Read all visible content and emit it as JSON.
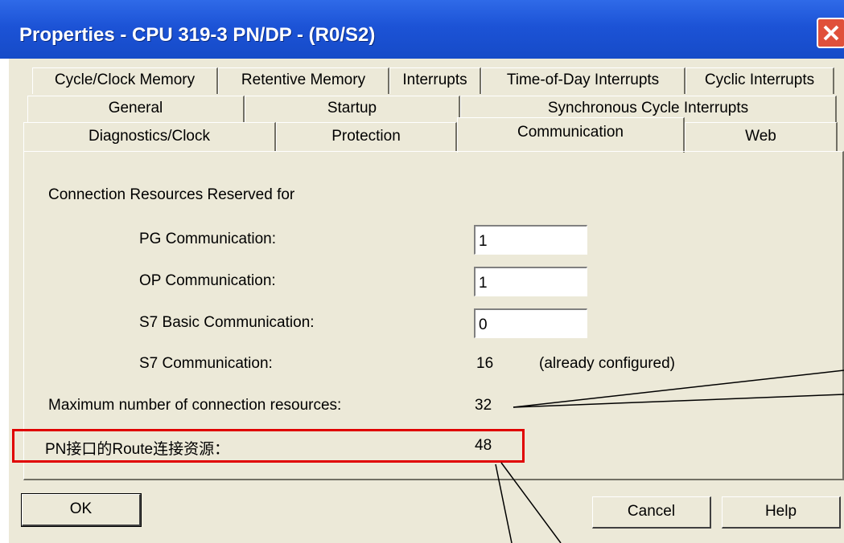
{
  "window": {
    "title": "Properties - CPU 319-3 PN/DP - (R0/S2)"
  },
  "tabs": {
    "row1": [
      "Cycle/Clock Memory",
      "Retentive Memory",
      "Interrupts",
      "Time-of-Day Interrupts",
      "Cyclic Interrupts"
    ],
    "row2": [
      "General",
      "Startup",
      "Synchronous Cycle Interrupts"
    ],
    "row3": [
      "Diagnostics/Clock",
      "Protection",
      "Communication",
      "Web"
    ],
    "active": "Communication"
  },
  "communication": {
    "section_title": "Connection Resources Reserved for",
    "pg_label": "PG Communication:",
    "pg_value": "1",
    "op_label": "OP Communication:",
    "op_value": "1",
    "s7basic_label": "S7 Basic Communication:",
    "s7basic_value": "0",
    "s7_label": "S7 Communication:",
    "s7_value": "16",
    "s7_note": "(already configured)",
    "max_label": "Maximum number of connection resources:",
    "max_value": "32",
    "route_label": "PN接口的Route连接资源：",
    "route_value": "48"
  },
  "buttons": {
    "ok": "OK",
    "cancel": "Cancel",
    "help": "Help"
  },
  "colors": {
    "titlebar": "#1c53d6",
    "dialog_bg": "#ece9d8",
    "highlight": "#e00000",
    "close": "#e0503a"
  }
}
